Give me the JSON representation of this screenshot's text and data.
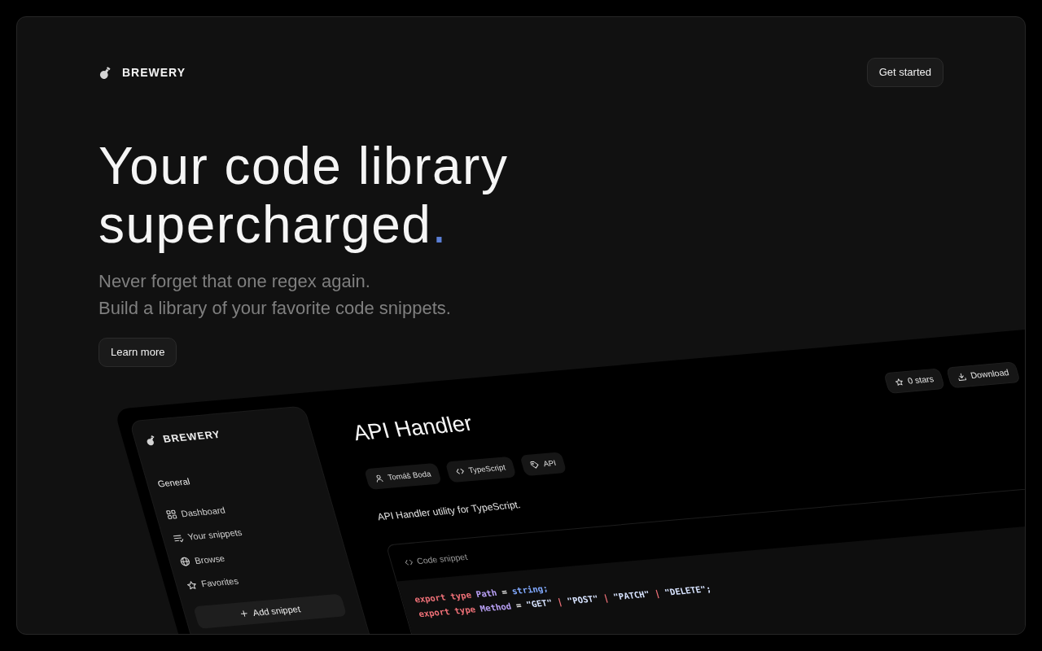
{
  "header": {
    "brand": "BREWERY",
    "cta": "Get started"
  },
  "hero": {
    "title_lines": [
      "Your code library",
      "supercharged"
    ],
    "title_accent": ".",
    "subtitle_lines": [
      "Never forget that one regex again.",
      "Build a library of your favorite code snippets."
    ],
    "button": "Learn more"
  },
  "app_preview": {
    "sidebar": {
      "brand": "BREWERY",
      "section": "General",
      "items": [
        {
          "label": "Dashboard",
          "selected": false
        },
        {
          "label": "Your snippets",
          "selected": false
        },
        {
          "label": "Browse",
          "selected": false
        },
        {
          "label": "Favorites",
          "selected": false
        }
      ],
      "add_button": "Add snippet"
    },
    "snippet": {
      "title": "API Handler",
      "actions": [
        {
          "label": "0 stars"
        },
        {
          "label": "Download"
        }
      ],
      "tags": [
        {
          "label": "Tomáš Boda"
        },
        {
          "label": "TypeScript"
        },
        {
          "label": "API"
        }
      ],
      "description": "API Handler utility for TypeScript.",
      "code_card": {
        "title": "Code snippet",
        "lines": [
          {
            "tokens": [
              {
                "kind": "keyword",
                "text": "export type "
              },
              {
                "kind": "type",
                "text": "Path"
              },
              {
                "kind": "punct",
                "text": " = "
              },
              {
                "kind": "builtin",
                "text": "string;"
              }
            ]
          },
          {
            "tokens": [
              {
                "kind": "keyword",
                "text": "export type "
              },
              {
                "kind": "type",
                "text": "Method"
              },
              {
                "kind": "punct",
                "text": " = "
              },
              {
                "kind": "string",
                "text": "\"GET\""
              },
              {
                "kind": "operator",
                "text": " | "
              },
              {
                "kind": "string",
                "text": "\"POST\""
              },
              {
                "kind": "operator",
                "text": " | "
              },
              {
                "kind": "string",
                "text": "\"PATCH\""
              },
              {
                "kind": "operator",
                "text": " | "
              },
              {
                "kind": "string",
                "text": "\"DELETE\";"
              }
            ]
          }
        ]
      }
    }
  }
}
